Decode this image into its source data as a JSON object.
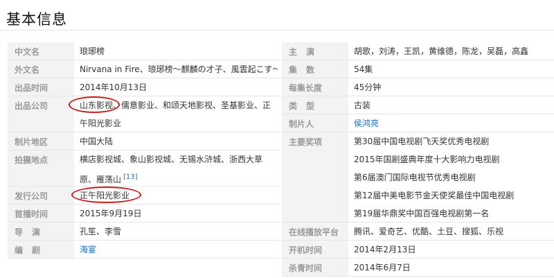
{
  "heading": "基本信息",
  "left": [
    {
      "label": "中文名",
      "lines": [
        "琅琊榜"
      ]
    },
    {
      "label": "外文名",
      "lines": [
        "Nirvana in Fire、琅琊榜～麒麟の才子、風雲起こす～"
      ]
    },
    {
      "label": "出品时间",
      "lines": [
        "2014年10月13日"
      ]
    },
    {
      "label": "出品公司",
      "lines": [
        "山东影视、儒意影业、和颂天地影视、圣基影业、正",
        "午阳光影业"
      ]
    },
    {
      "label": "制片地区",
      "lines": [
        "中国大陆"
      ]
    },
    {
      "label": "拍摄地点",
      "lines": [
        "横店影视城、象山影视城、无锡水浒城、浙西大草",
        "原、雁荡山"
      ],
      "ref": "[13]"
    },
    {
      "label": "发行公司",
      "lines": [
        "正午阳光影业"
      ]
    },
    {
      "label": "首播时间",
      "lines": [
        "2015年9月19日"
      ]
    },
    {
      "label": "导演",
      "lines": [
        "孔笙、李雪"
      ]
    },
    {
      "label": "编剧",
      "lines": [
        "海宴"
      ]
    }
  ],
  "right": [
    {
      "label": "主演",
      "lines": [
        "胡歌，刘涛，王凯，黄维德，陈龙，吴磊，高鑫"
      ]
    },
    {
      "label": "集数",
      "lines": [
        "54集"
      ]
    },
    {
      "label": "每集长度",
      "lines": [
        "45分钟"
      ]
    },
    {
      "label": "类型",
      "lines": [
        "古装"
      ]
    },
    {
      "label": "制片人",
      "lines": [
        "侯鸿亮"
      ]
    },
    {
      "label": "主要奖项",
      "lines": [
        "第30届中国电视剧飞天奖优秀电视剧",
        "2015年国剧盛典年度十大影响力电视剧",
        "第6届澳门国际电视节优秀电视剧",
        "第12届中美电影节金天使奖最佳中国电视剧",
        "第19届华鼎奖中国百强电视剧第一名"
      ]
    },
    {
      "label": "在线播放平台",
      "lines": [
        "腾讯、爱奇艺、优酷、土豆、搜狐、乐视"
      ]
    },
    {
      "label": "开机时间",
      "lines": [
        "2014年2月13日"
      ]
    },
    {
      "label": "杀青时间",
      "lines": [
        "2014年6月7日"
      ]
    }
  ]
}
